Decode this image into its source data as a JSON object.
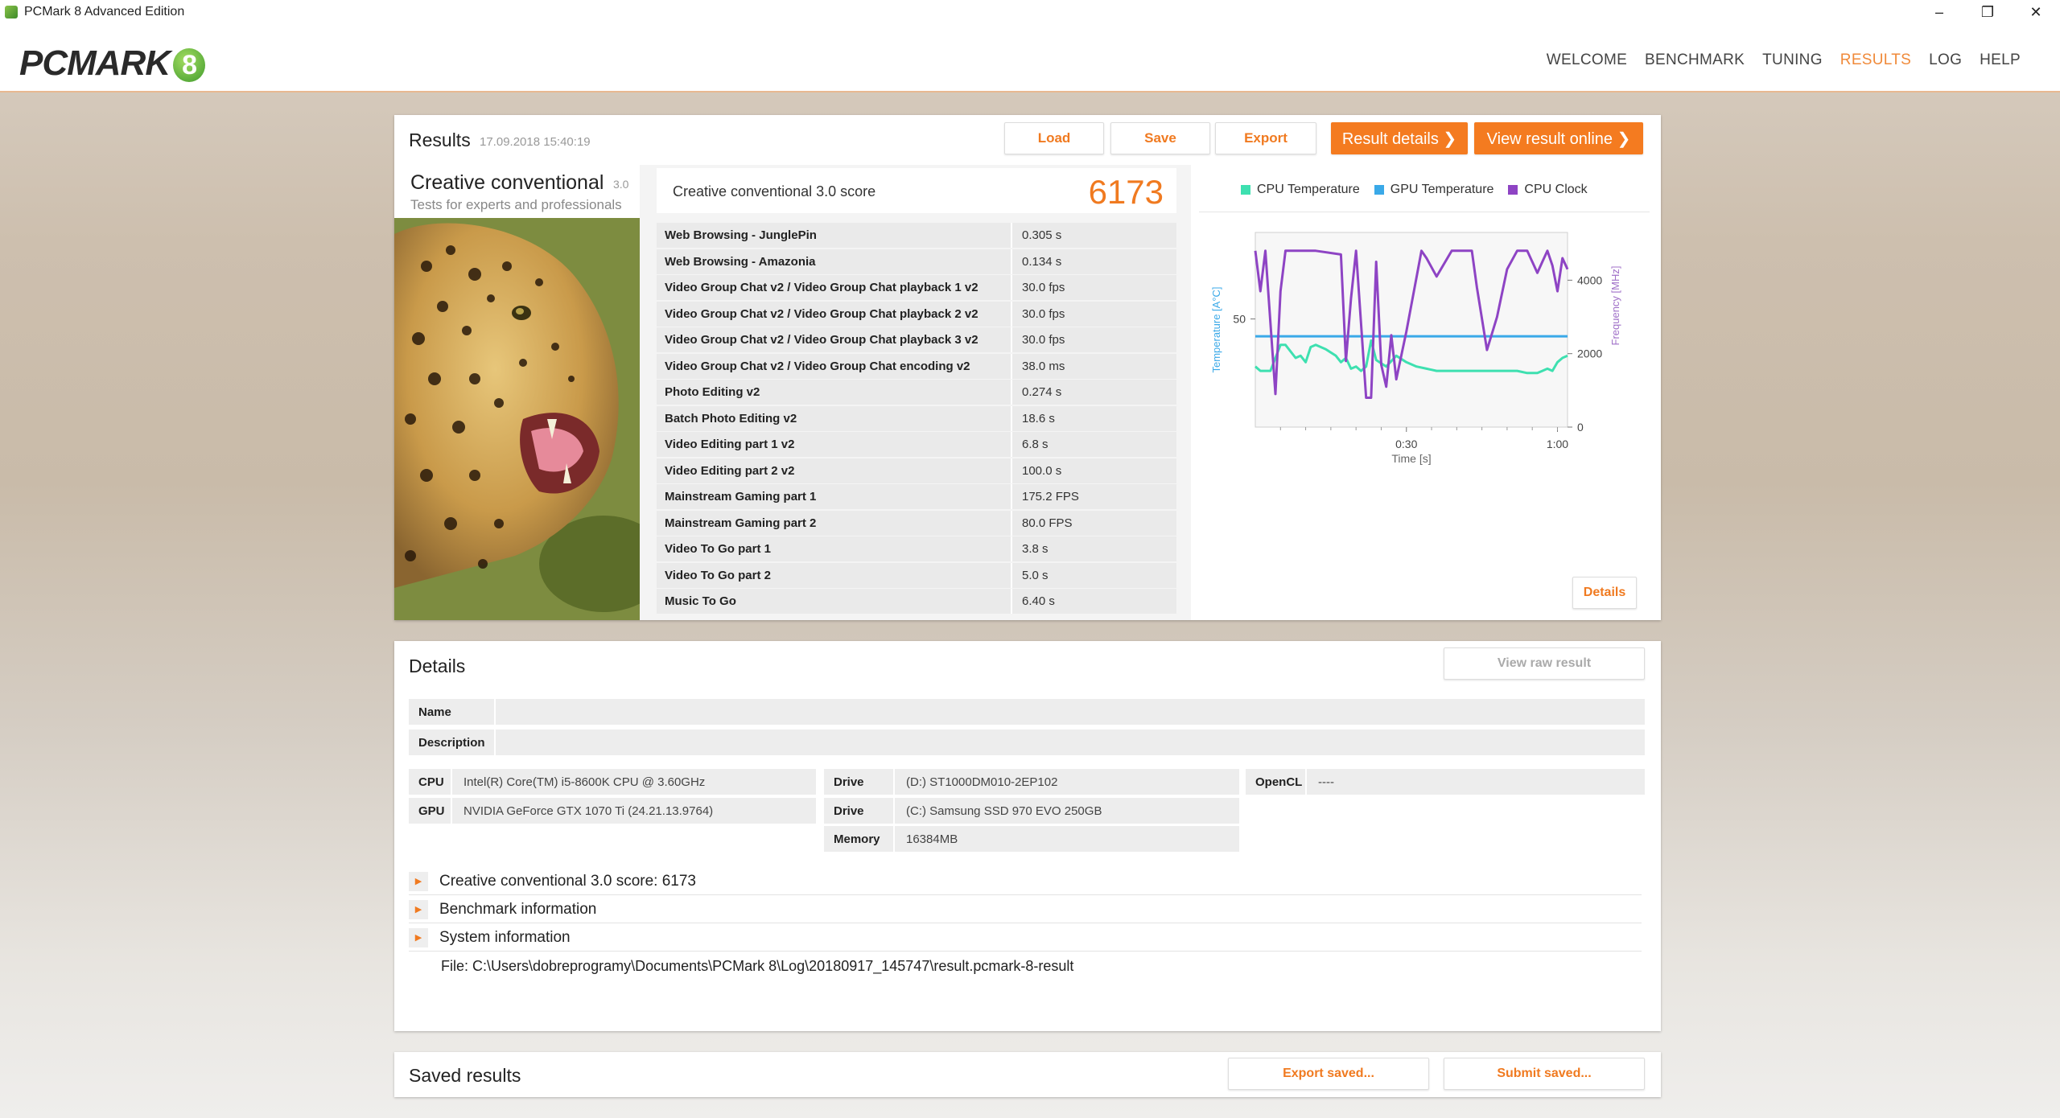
{
  "window": {
    "title": "PCMark 8 Advanced Edition",
    "minimize": "–",
    "maximize": "❐",
    "close": "✕"
  },
  "logo": {
    "text": "PCMARK",
    "mark": "8"
  },
  "nav": [
    {
      "label": "WELCOME"
    },
    {
      "label": "BENCHMARK"
    },
    {
      "label": "TUNING"
    },
    {
      "label": "RESULTS",
      "active": true
    },
    {
      "label": "LOG"
    },
    {
      "label": "HELP"
    }
  ],
  "results": {
    "title": "Results",
    "timestamp": "17.09.2018 15:40:19",
    "buttons": {
      "load": "Load",
      "save": "Save",
      "export": "Export",
      "result_details": "Result details ❯",
      "view_online": "View result online ❯"
    },
    "test_name": "Creative conventional",
    "test_version": "3.0",
    "test_subtitle": "Tests for experts and professionals",
    "score_label": "Creative conventional 3.0 score",
    "score": "6173",
    "rows": [
      {
        "name": "Web Browsing - JunglePin",
        "value": "0.305 s"
      },
      {
        "name": "Web Browsing - Amazonia",
        "value": "0.134 s"
      },
      {
        "name": "Video Group Chat v2 / Video Group Chat playback 1 v2",
        "value": "30.0 fps"
      },
      {
        "name": "Video Group Chat v2 / Video Group Chat playback 2 v2",
        "value": "30.0 fps"
      },
      {
        "name": "Video Group Chat v2 / Video Group Chat playback 3 v2",
        "value": "30.0 fps"
      },
      {
        "name": "Video Group Chat v2 / Video Group Chat encoding v2",
        "value": "38.0 ms"
      },
      {
        "name": "Photo Editing v2",
        "value": "0.274 s"
      },
      {
        "name": "Batch Photo Editing v2",
        "value": "18.6 s"
      },
      {
        "name": "Video Editing part 1 v2",
        "value": "6.8 s"
      },
      {
        "name": "Video Editing part 2 v2",
        "value": "100.0 s"
      },
      {
        "name": "Mainstream Gaming part 1",
        "value": "175.2 FPS"
      },
      {
        "name": "Mainstream Gaming part 2",
        "value": "80.0 FPS"
      },
      {
        "name": "Video To Go part 1",
        "value": "3.8 s"
      },
      {
        "name": "Video To Go part 2",
        "value": "5.0 s"
      },
      {
        "name": "Music To Go",
        "value": "6.40 s"
      }
    ],
    "chart_details_button": "Details"
  },
  "chart_data": {
    "type": "line",
    "legend": [
      "CPU Temperature",
      "GPU Temperature",
      "CPU Clock"
    ],
    "colors": {
      "cpu_temp": "#3ee0b0",
      "gpu_temp": "#3aa9e8",
      "cpu_clock": "#8e44c4"
    },
    "xlabel": "Time [s]",
    "ylabel_left": "Temperature [A°C]",
    "ylabel_right": "Frequency [MHz]",
    "x_ticks": [
      "0:30",
      "1:00"
    ],
    "y_left_ticks": [
      "50"
    ],
    "y_right_ticks": [
      "0",
      "2000",
      "4000"
    ],
    "xlim": [
      0,
      62
    ],
    "ylim_left": [
      0,
      90
    ],
    "ylim_right": [
      0,
      5300
    ],
    "series": [
      {
        "name": "CPU Temperature",
        "axis": "left",
        "x": [
          0,
          1,
          3,
          5,
          6,
          8,
          9,
          10,
          11,
          12,
          14,
          16,
          17,
          18,
          19,
          20,
          21,
          22,
          23,
          24,
          26,
          28,
          30,
          32,
          34,
          36,
          38,
          40,
          42,
          44,
          46,
          48,
          50,
          52,
          54,
          56,
          57,
          58,
          59,
          60,
          61,
          62
        ],
        "y": [
          28,
          26,
          26,
          38,
          38,
          32,
          33,
          30,
          37,
          38,
          36,
          33,
          30,
          32,
          27,
          28,
          26,
          28,
          40,
          31,
          28,
          33,
          30,
          28,
          27,
          26,
          26,
          26,
          26,
          26,
          26,
          26,
          26,
          26,
          25,
          25,
          26,
          27,
          26,
          30,
          32,
          33
        ]
      },
      {
        "name": "GPU Temperature",
        "axis": "left",
        "x": [
          0,
          10,
          20,
          25,
          30,
          35,
          40,
          45,
          50,
          55,
          62
        ],
        "y": [
          42,
          42,
          42,
          42,
          42,
          42,
          42,
          42,
          42,
          42,
          42
        ]
      },
      {
        "name": "CPU Clock",
        "axis": "right",
        "x": [
          0,
          1,
          2,
          4,
          5,
          6,
          8,
          10,
          12,
          17,
          18,
          19,
          20,
          22,
          23,
          24,
          25,
          26,
          27,
          28,
          30,
          33,
          34,
          36,
          39,
          41,
          43,
          44,
          46,
          48,
          50,
          52,
          54,
          56,
          57,
          58,
          59,
          60,
          61,
          62
        ],
        "y": [
          4800,
          3700,
          4800,
          900,
          3700,
          4800,
          4800,
          4800,
          4800,
          4700,
          1800,
          3500,
          4800,
          800,
          800,
          4500,
          1700,
          1100,
          2500,
          1300,
          2600,
          4800,
          4600,
          4100,
          4800,
          4800,
          4800,
          3800,
          2100,
          3000,
          4300,
          4800,
          4800,
          4200,
          4500,
          4800,
          4400,
          3700,
          4600,
          4300
        ]
      }
    ]
  },
  "details": {
    "title": "Details",
    "view_raw": "View raw result",
    "name_label": "Name",
    "name_value": "",
    "description_label": "Description",
    "description_value": "",
    "cpu_label": "CPU",
    "cpu_value": "Intel(R) Core(TM) i5-8600K CPU @ 3.60GHz",
    "gpu_label": "GPU",
    "gpu_value": "NVIDIA GeForce GTX 1070 Ti (24.21.13.9764)",
    "drive1_label": "Drive",
    "drive1_value": "(D:) ST1000DM010-2EP102",
    "drive2_label": "Drive",
    "drive2_value": "(C:) Samsung SSD 970 EVO 250GB",
    "memory_label": "Memory",
    "memory_value": "16384MB",
    "opencl_label": "OpenCL",
    "opencl_value": "----",
    "expanders": [
      {
        "label": "Creative conventional 3.0 score: 6173"
      },
      {
        "label": "Benchmark information"
      },
      {
        "label": "System information"
      }
    ],
    "file_path": "File: C:\\Users\\dobreprogramy\\Documents\\PCMark 8\\Log\\20180917_145747\\result.pcmark-8-result"
  },
  "saved": {
    "title": "Saved results",
    "export_saved": "Export saved...",
    "submit_saved": "Submit saved..."
  }
}
